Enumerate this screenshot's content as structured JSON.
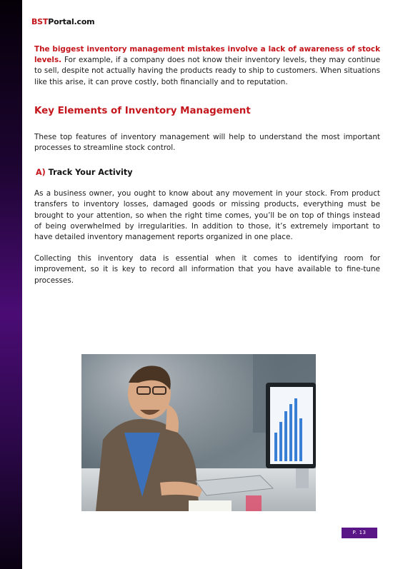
{
  "header": {
    "logo_brand": "BST",
    "logo_rest": "Portal.com"
  },
  "intro": {
    "bold_lead": "The biggest inventory management mistakes involve a lack of awareness of stock levels.",
    "body": " For example, if a company does not know their inventory levels, they may continue to sell, despite not actually having the products ready to ship to customers. When situations like this arise, it can prove costly, both financially and to reputation."
  },
  "section": {
    "title": "Key Elements of Inventory Management",
    "intro": "These top features of inventory management will help to understand the most important processes to streamline stock control."
  },
  "subsection": {
    "letter": "A)",
    "title": " Track Your Activity",
    "paragraphs": [
      "As a business owner, you ought to know about any movement in your stock. From product transfers to inventory losses, damaged goods or missing products, everything must be brought to your attention, so when the right time comes, you’ll be on top of things instead of being overwhelmed by irregularities. In addition to those, it’s extremely important to have detailed inventory management reports organized in one place.",
      "Collecting this inventory data is essential when it comes to identifying room for improvement, so it is key to record all information that you have available to fine-tune processes."
    ]
  },
  "footer": {
    "page_label": "P. 13"
  }
}
